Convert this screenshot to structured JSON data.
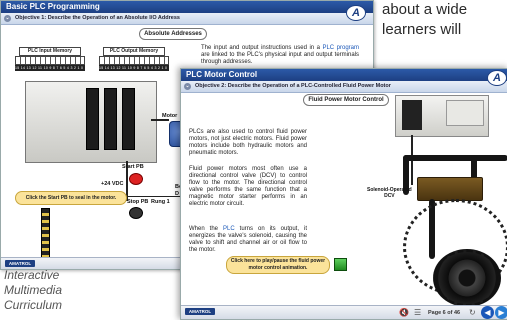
{
  "background": {
    "text_lines": [
      "about a wide",
      "learners will"
    ],
    "caption_lines": [
      "Interactive",
      "Multimedia",
      "Curriculum"
    ]
  },
  "window_back": {
    "title": "Basic PLC Programming",
    "objective": "Objective 1: Describe the Operation of an Absolute I/O Address",
    "section_button": "Absolute Addresses",
    "plc_input_memory": "PLC Input Memory",
    "plc_output_memory": "PLC Output Memory",
    "bit_numbers": "15 14 13 12 11 10 9 8 7 6 5 4 3 2 1 0",
    "paragraph_prefix": "The input and output instructions used in a ",
    "paragraph_link": "PLC program",
    "paragraph_suffix": " are linked to the PLC's physical input and output terminals through addresses.",
    "labels": {
      "motor": "Motor",
      "start_pb": "Start PB",
      "stop_pb": "Stop PB",
      "voltage": "+24 VDC",
      "rung": "Rung 1",
      "partial_b": "Bo",
      "partial_d": "D"
    },
    "callout": "Click the Start PB to seal in the motor.",
    "brand": "AMATROL",
    "logo_letter": "A"
  },
  "window_front": {
    "title": "PLC Motor Control",
    "objective": "Objective 2: Describe the Operation of a PLC-Controlled Fluid Power Motor",
    "section_button": "Fluid Power Motor Control",
    "paragraphs": [
      {
        "text": "PLCs are also used to control fluid power motors, not just electric motors. Fluid power motors include both hydraulic motors and pneumatic motors."
      },
      {
        "text": "Fluid power motors most often use a directional control valve (DCV) to control flow to the motor. The directional control valve performs the same function that a magnetic motor starter performs in an electric motor circuit."
      },
      {
        "prefix": "When the ",
        "link": "PLC",
        "suffix": " turns on its output, it energizes the valve's solenoid, causing the valve to shift and channel air or oil flow to the motor."
      }
    ],
    "callout": "Click here to play/pause the fluid power motor control animation.",
    "solenoid_label_line1": "Solenoid-Operated",
    "solenoid_label_line2": "DCV",
    "page_indicator": "Page 6 of 46",
    "brand": "AMATROL",
    "logo_letter": "A",
    "icons": [
      "mute-icon",
      "menu-icon",
      "refresh-icon",
      "back-arrow-icon",
      "forward-arrow-icon"
    ],
    "colors": {
      "title_bar": "#1d3f82",
      "link": "#1a57b8",
      "callout": "#fbe39a",
      "play_button": "#2fa52f"
    }
  }
}
